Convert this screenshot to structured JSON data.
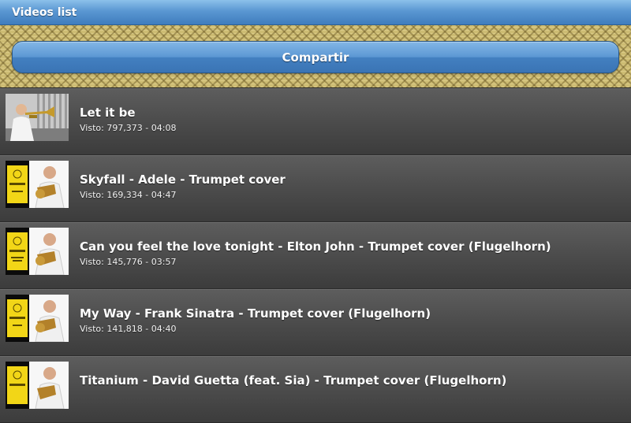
{
  "header": {
    "title": "Videos list"
  },
  "banner": {
    "share_label": "Compartir"
  },
  "videos": [
    {
      "title": "Let it be",
      "meta": "Visto: 797,373 - 04:08",
      "thumb_icon": "trumpet-studio-thumbnail-icon"
    },
    {
      "title": "Skyfall - Adele - Trumpet cover",
      "meta": "Visto: 169,334 - 04:47",
      "thumb_icon": "bellepix-trumpet-thumbnail-icon"
    },
    {
      "title": "Can you feel the love tonight - Elton John - Trumpet cover (Flugelhorn)",
      "meta": "Visto: 145,776 - 03:57",
      "thumb_icon": "bellepix-trumpet-thumbnail-icon"
    },
    {
      "title": "My Way - Frank Sinatra - Trumpet cover (Flugelhorn)",
      "meta": "Visto: 141,818 - 04:40",
      "thumb_icon": "bellepix-trumpet-thumbnail-icon"
    },
    {
      "title": "Titanium - David Guetta (feat. Sia) - Trumpet cover (Flugelhorn)",
      "meta": "",
      "thumb_icon": "bellepix-trumpet-thumbnail-icon"
    }
  ],
  "colors": {
    "header_blue": "#5a97d2",
    "button_blue": "#4380c1",
    "list_background": "#4a4a4a",
    "banner_gold": "#cdbc73",
    "thumb_yellow": "#f2d617"
  }
}
